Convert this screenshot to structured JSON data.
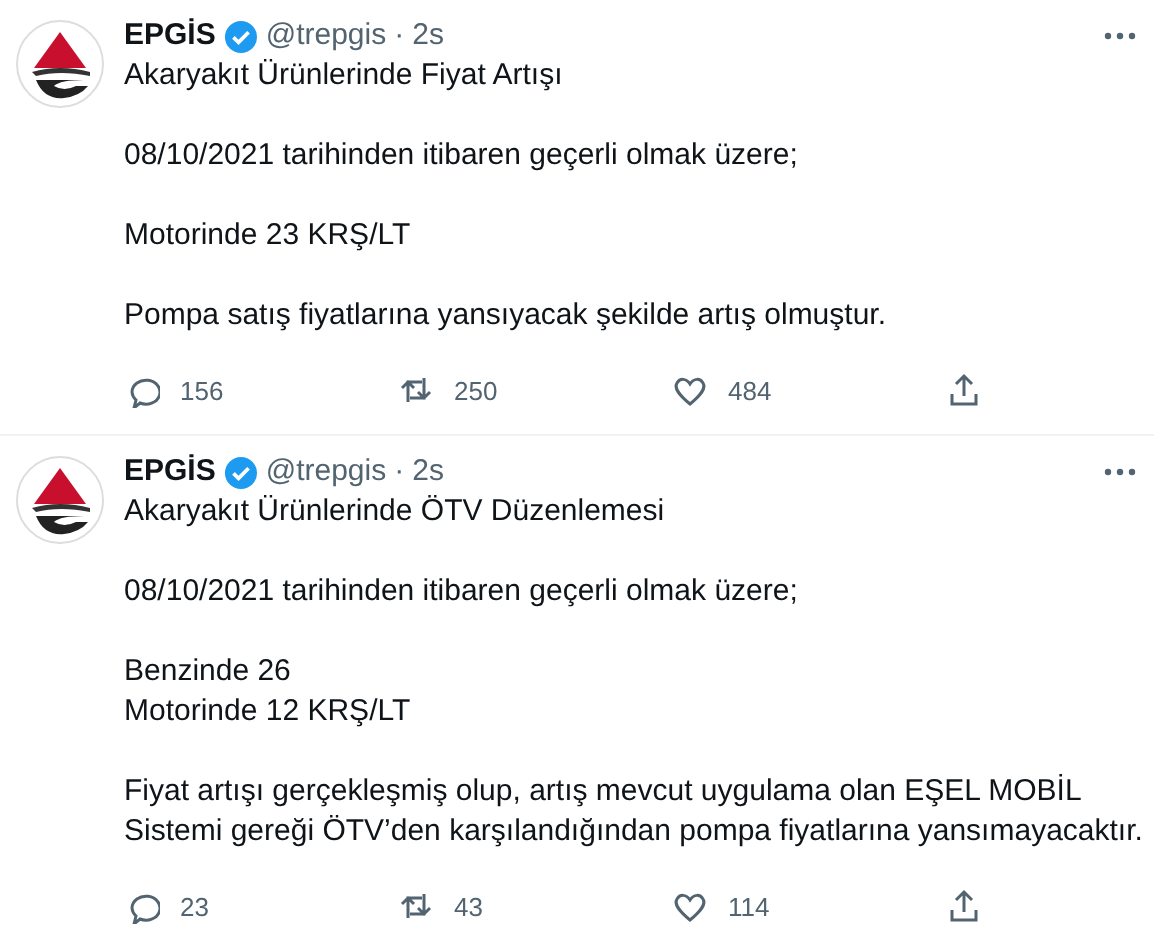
{
  "tweets": [
    {
      "author": {
        "name": "EPGİS",
        "verified": true,
        "handle": "@trepgis",
        "separator": "·",
        "time": "2s"
      },
      "paragraphs": [
        [
          "Akaryakıt Ürünlerinde Fiyat Artışı"
        ],
        [
          "08/10/2021 tarihinden itibaren geçerli olmak üzere;"
        ],
        [
          "Motorinde 23 KRŞ/LT"
        ],
        [
          "Pompa satış fiyatlarına yansıyacak şekilde artış olmuştur."
        ]
      ],
      "actions": {
        "replies": "156",
        "retweets": "250",
        "likes": "484"
      }
    },
    {
      "author": {
        "name": "EPGİS",
        "verified": true,
        "handle": "@trepgis",
        "separator": "·",
        "time": "2s"
      },
      "paragraphs": [
        [
          "Akaryakıt Ürünlerinde ÖTV Düzenlemesi"
        ],
        [
          "08/10/2021 tarihinden itibaren geçerli olmak üzere;"
        ],
        [
          "Benzinde 26",
          "Motorinde 12 KRŞ/LT"
        ],
        [
          "Fiyat artışı gerçekleşmiş olup, artış mevcut uygulama olan EŞEL MOBİL",
          "Sistemi gereği ÖTV’den karşılandığından pompa fiyatlarına yansımayacaktır."
        ]
      ],
      "actions": {
        "replies": "23",
        "retweets": "43",
        "likes": "114"
      }
    }
  ]
}
